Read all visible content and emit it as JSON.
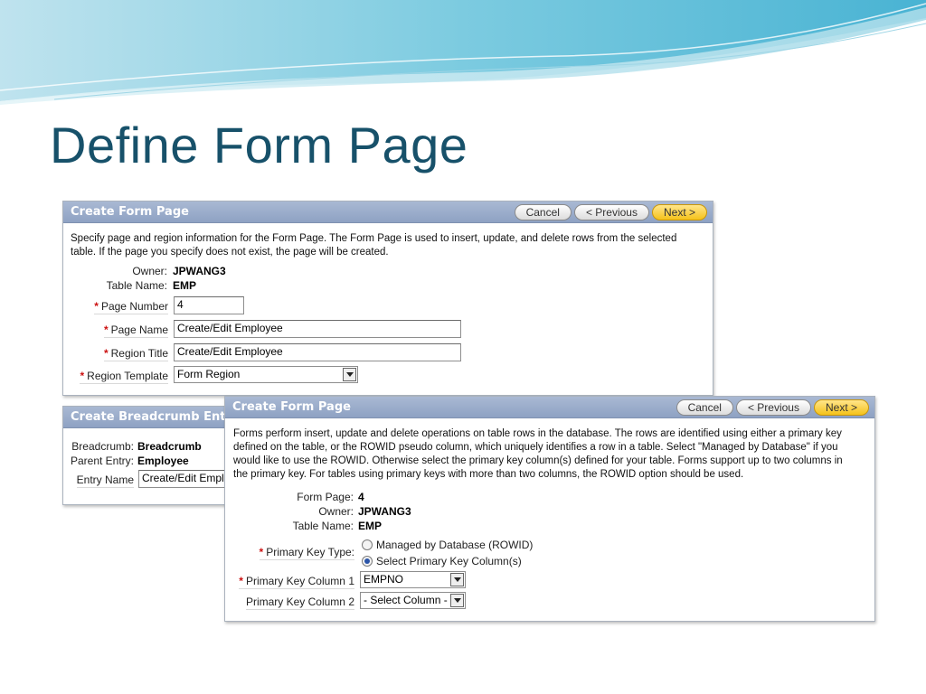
{
  "slide": {
    "title": "Define Form Page"
  },
  "theme": {
    "title_color": "#17516a",
    "panel_header": "#8ea2c3",
    "next_button": "#f5c21b",
    "required_mark": "#cc1111"
  },
  "panel1": {
    "title": "Create Form Page",
    "buttons": {
      "cancel": "Cancel",
      "previous": "< Previous",
      "next": "Next >"
    },
    "description_line1": "Specify page and region information for the Form Page. The Form Page is used to insert, update, and delete rows from the selected",
    "description_line2": "table. If the page you specify does not exist, the page will be created.",
    "owner_label": "Owner:",
    "owner_value": "JPWANG3",
    "table_label": "Table Name:",
    "table_value": "EMP",
    "page_number_label": "Page Number",
    "page_number_value": "4",
    "page_name_label": "Page Name",
    "page_name_value": "Create/Edit Employee",
    "region_title_label": "Region Title",
    "region_title_value": "Create/Edit Employee",
    "region_template_label": "Region Template",
    "region_template_value": "Form Region",
    "required_mark": "*"
  },
  "panel_breadcrumb": {
    "title": "Create Breadcrumb Entry",
    "breadcrumb_label": "Breadcrumb:",
    "breadcrumb_value": "Breadcrumb",
    "parent_label": "Parent Entry:",
    "parent_value": "Employee",
    "entry_name_label": "Entry Name",
    "entry_name_value": "Create/Edit Employee"
  },
  "panel2": {
    "title": "Create Form Page",
    "buttons": {
      "cancel": "Cancel",
      "previous": "< Previous",
      "next": "Next >"
    },
    "description_lines": [
      "Forms perform insert, update and delete operations on table rows in the database. The rows are identified using either a primary key",
      "defined on the table, or the ROWID pseudo column, which uniquely identifies a row in a table. Select \"Managed by Database\" if you",
      "would like to use the ROWID. Otherwise select the primary key column(s) defined for your table. Forms support up to two columns in",
      "the primary key. For tables using primary keys with more than two columns, the ROWID option should be used."
    ],
    "form_page_label": "Form Page:",
    "form_page_value": "4",
    "owner_label": "Owner:",
    "owner_value": "JPWANG3",
    "table_label": "Table Name:",
    "table_value": "EMP",
    "pk_type_label": "Primary Key Type:",
    "pk_type_options": [
      "Managed by Database (ROWID)",
      "Select Primary Key Column(s)"
    ],
    "pk_type_selected": 1,
    "pk_col1_label": "Primary Key Column 1",
    "pk_col1_value": "EMPNO",
    "pk_col2_label": "Primary Key Column 2",
    "pk_col2_value": "- Select Column -",
    "required_mark": "*"
  }
}
